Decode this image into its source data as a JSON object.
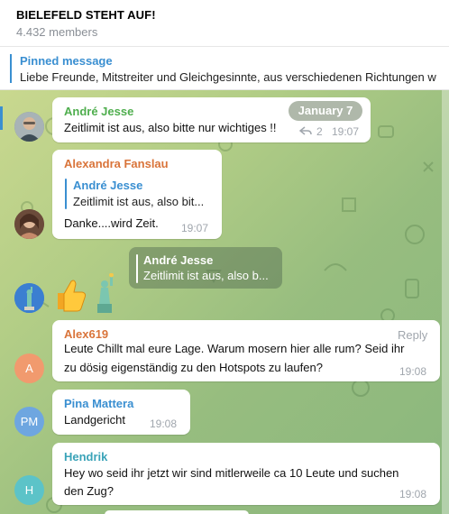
{
  "header": {
    "title": "BIELEFELD STEHT AUF!",
    "members": "4.432 members"
  },
  "pinned": {
    "title": "Pinned message",
    "text": "Liebe Freunde, Mitstreiter und Gleichgesinnte,  aus verschiedenen Richtungen w"
  },
  "date_pill": "January 7",
  "colors": {
    "accent": "#3a8fd1",
    "chat_bg": "#a9c885"
  },
  "messages": [
    {
      "sender": "André Jesse",
      "sender_color": "#4fae4e",
      "text": "Zeitlimit ist aus, also bitte nur wichtiges !!",
      "replies": "2",
      "reply_icon": "reply-arrow-icon",
      "time": "19:07"
    },
    {
      "sender": "Alexandra Fanslau",
      "sender_color": "#d9743a",
      "reply_to": {
        "name": "André Jesse",
        "text": "Zeitlimit ist aus, also bit..."
      },
      "text": "Danke....wird Zeit.",
      "time": "19:07"
    },
    {
      "reply_to": {
        "name": "André Jesse",
        "text": "Zeitlimit ist aus, also b..."
      },
      "sticker": "thumbs-up-emoji",
      "sticker2": "statue-of-liberty-emoji"
    },
    {
      "sender": "Alex619",
      "sender_color": "#d9743a",
      "reply_label": "Reply",
      "text_line1": "Leute Chillt mal eure Lage. Warum mosern hier alle rum? Seid ihr",
      "text_line2": "zu dösig eigenständig zu den Hotspots zu laufen?",
      "time": "19:08",
      "avatar_initials": "A",
      "avatar_color": "#f19a6e"
    },
    {
      "sender": "Pina Mattera",
      "sender_color": "#3a8fd1",
      "text": "Landgericht",
      "time": "19:08",
      "avatar_initials": "PM",
      "avatar_color": "#6ea6e0"
    },
    {
      "sender": "Hendrik",
      "sender_color": "#3aa3b8",
      "text_line1": "Hey wo seid ihr jetzt wir sind mitlerweile ca 10 Leute und suchen",
      "text_line2": "den Zug?",
      "time": "19:08",
      "avatar_initials": "H",
      "avatar_color": "#5cc3c8"
    }
  ]
}
